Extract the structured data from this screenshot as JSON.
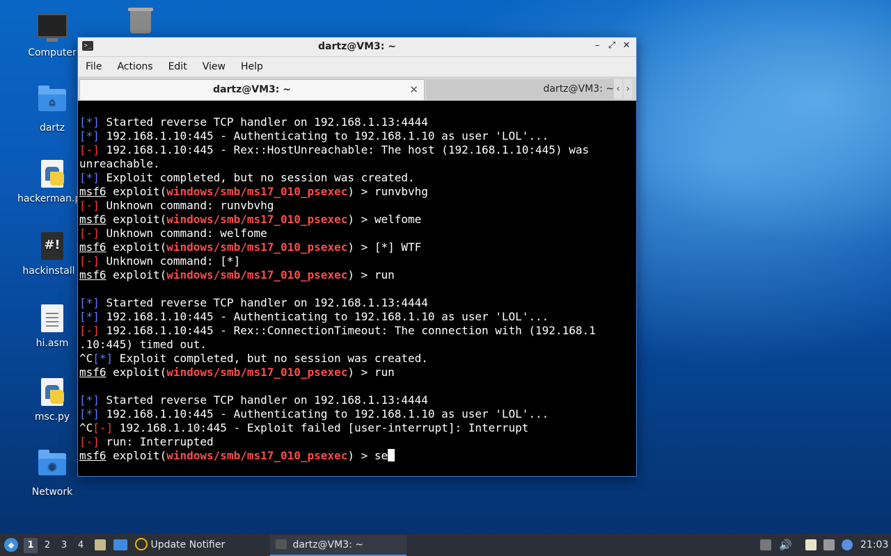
{
  "desktop": {
    "icons": [
      {
        "label": "Computer"
      },
      {
        "label": ""
      },
      {
        "label": "dartz"
      },
      {
        "label": "hackerman.py"
      },
      {
        "label": "hackinstall"
      },
      {
        "label": "hi.asm"
      },
      {
        "label": "msc.py"
      },
      {
        "label": "Network"
      }
    ]
  },
  "window": {
    "title": "dartz@VM3: ~",
    "menu": [
      "File",
      "Actions",
      "Edit",
      "View",
      "Help"
    ],
    "tabs": [
      {
        "label": "dartz@VM3: ~",
        "active": true
      },
      {
        "label": "dartz@VM3: ~",
        "active": false
      }
    ]
  },
  "terminal": {
    "module": "windows/smb/ms17_010_psexec",
    "lines": [
      {
        "kind": "info",
        "tag": "[*]",
        "text": " Started reverse TCP handler on 192.168.1.13:4444"
      },
      {
        "kind": "info",
        "tag": "[*]",
        "text": " 192.168.1.10:445 - Authenticating to 192.168.1.10 as user 'LOL'..."
      },
      {
        "kind": "err",
        "tag": "[-]",
        "text": " 192.168.1.10:445 - Rex::HostUnreachable: The host (192.168.1.10:445) was"
      },
      {
        "kind": "plain",
        "text": "unreachable."
      },
      {
        "kind": "info",
        "tag": "[*]",
        "text": " Exploit completed, but no session was created."
      },
      {
        "kind": "prompt",
        "cmd": "runvbvhg"
      },
      {
        "kind": "err",
        "tag": "[-]",
        "text": " Unknown command: runvbvhg"
      },
      {
        "kind": "prompt",
        "cmd": "welfome"
      },
      {
        "kind": "err",
        "tag": "[-]",
        "text": " Unknown command: welfome"
      },
      {
        "kind": "prompt",
        "cmd": "[*] WTF"
      },
      {
        "kind": "err",
        "tag": "[-]",
        "text": " Unknown command: [*]"
      },
      {
        "kind": "prompt",
        "cmd": "run"
      },
      {
        "kind": "plain",
        "text": ""
      },
      {
        "kind": "info",
        "tag": "[*]",
        "text": " Started reverse TCP handler on 192.168.1.13:4444"
      },
      {
        "kind": "info",
        "tag": "[*]",
        "text": " 192.168.1.10:445 - Authenticating to 192.168.1.10 as user 'LOL'..."
      },
      {
        "kind": "err",
        "tag": "[-]",
        "text": " 192.168.1.10:445 - Rex::ConnectionTimeout: The connection with (192.168.1"
      },
      {
        "kind": "plain",
        "text": ".10:445) timed out."
      },
      {
        "kind": "info",
        "prefix": "^C",
        "tag": "[*]",
        "text": " Exploit completed, but no session was created."
      },
      {
        "kind": "prompt",
        "cmd": "run"
      },
      {
        "kind": "plain",
        "text": ""
      },
      {
        "kind": "info",
        "tag": "[*]",
        "text": " Started reverse TCP handler on 192.168.1.13:4444"
      },
      {
        "kind": "info",
        "tag": "[*]",
        "text": " 192.168.1.10:445 - Authenticating to 192.168.1.10 as user 'LOL'..."
      },
      {
        "kind": "err",
        "prefix": "^C",
        "tag": "[-]",
        "text": " 192.168.1.10:445 - Exploit failed [user-interrupt]: Interrupt"
      },
      {
        "kind": "err",
        "tag": "[-]",
        "text": " run: Interrupted"
      },
      {
        "kind": "prompt",
        "cmd": "se",
        "cursor": true
      }
    ]
  },
  "taskbar": {
    "workspaces": [
      "1",
      "2",
      "3",
      "4"
    ],
    "active_workspace": "1",
    "tasks": [
      {
        "label": "Update Notifier",
        "icon": "update-notifier-icon"
      },
      {
        "label": "dartz@VM3: ~",
        "icon": "terminal-icon",
        "active": true
      }
    ],
    "clock": "21:03"
  }
}
